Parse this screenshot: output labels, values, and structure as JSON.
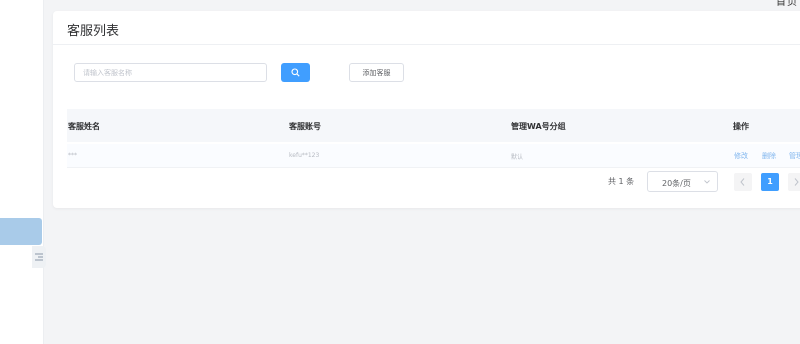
{
  "header": {
    "nav_home": "首页"
  },
  "card": {
    "title": "客服列表"
  },
  "search": {
    "placeholder": "请输入客服名称"
  },
  "toolbar": {
    "add_label": "添加客服"
  },
  "table": {
    "columns": [
      "客服姓名",
      "客服账号",
      "管理WA号分组",
      "操作"
    ],
    "rows": [
      {
        "name": "***",
        "account": "kefu**123",
        "group": "默认",
        "ops": [
          "修改",
          "删除",
          "管理"
        ]
      }
    ]
  },
  "pagination": {
    "total": "共 1 条",
    "page_size": "20条/页",
    "current": "1"
  },
  "colors": {
    "primary": "#409eff",
    "sidebar_active": "#a9cbe9"
  }
}
